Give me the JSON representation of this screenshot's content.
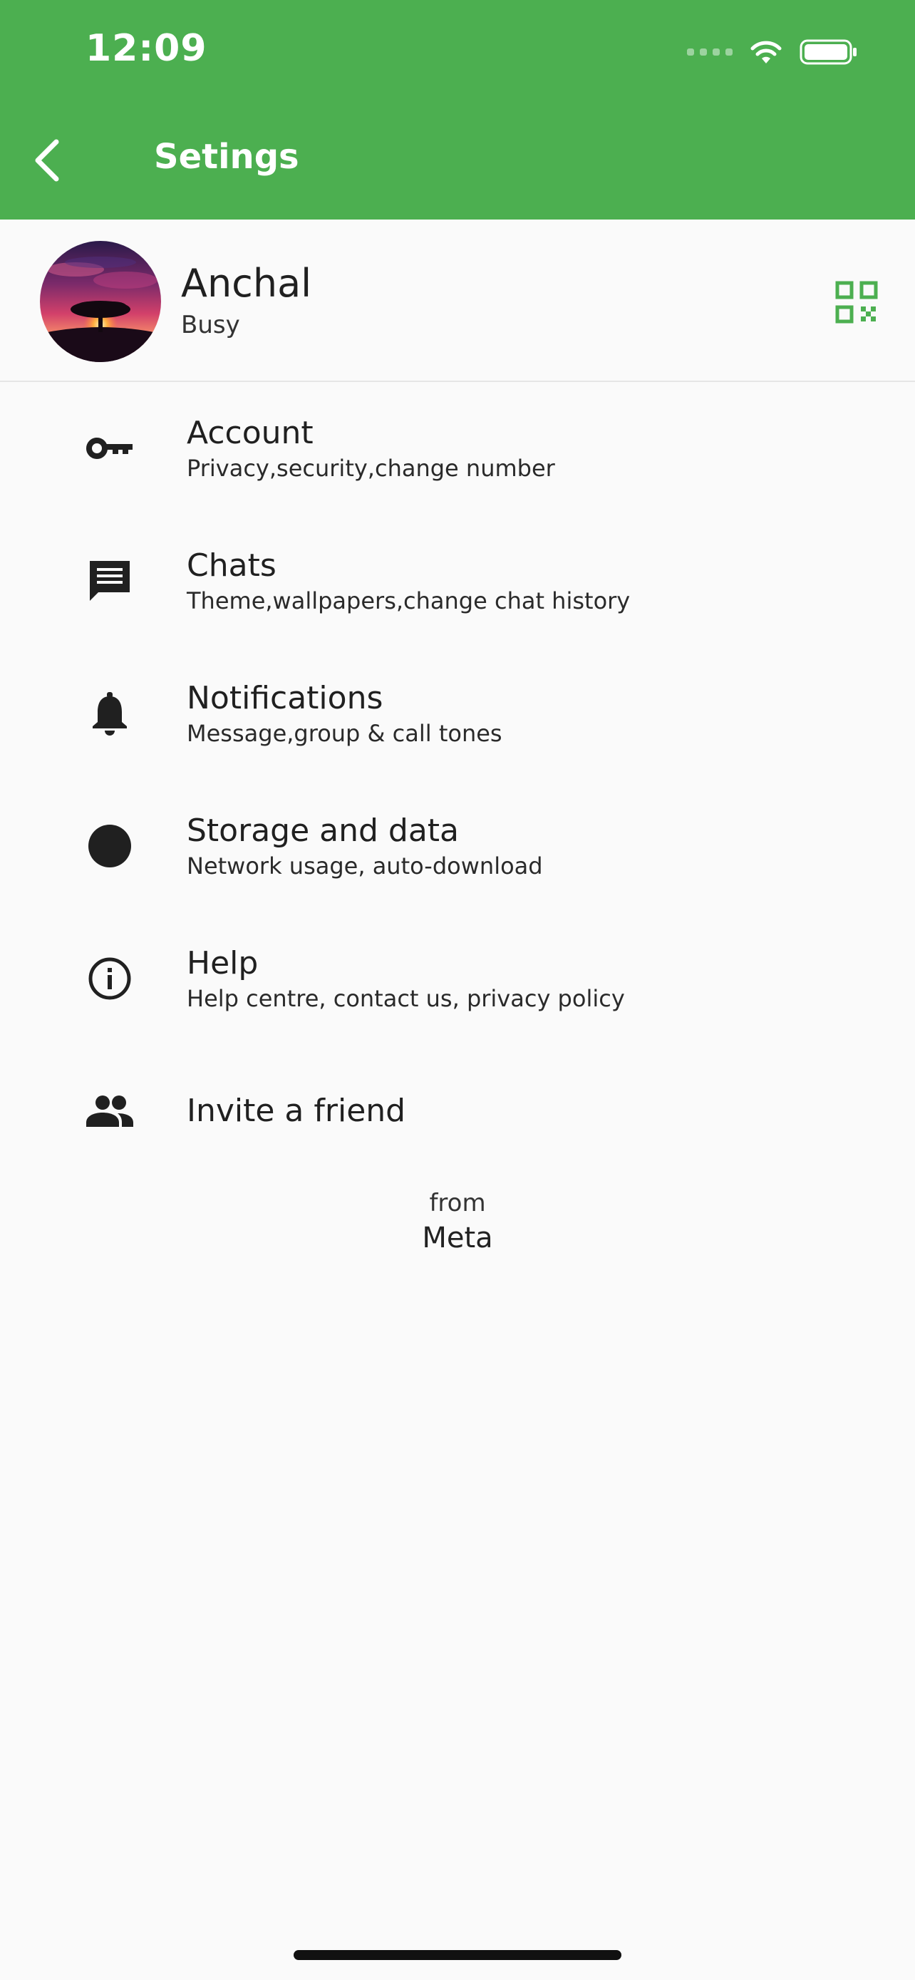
{
  "status_bar": {
    "time": "12:09"
  },
  "app_bar": {
    "title": "Setings",
    "back_icon": "chevron-left-icon",
    "background": "#4caf50"
  },
  "profile": {
    "name": "Anchal",
    "status": "Busy",
    "qr_icon": "qr-code-icon",
    "accent": "#4caf50"
  },
  "settings": [
    {
      "icon": "key-icon",
      "title": "Account",
      "subtitle": "Privacy,security,change number"
    },
    {
      "icon": "chat-icon",
      "title": "Chats",
      "subtitle": "Theme,wallpapers,change chat history"
    },
    {
      "icon": "bell-icon",
      "title": "Notifications",
      "subtitle": "Message,group & call tones"
    },
    {
      "icon": "circle-icon",
      "title": "Storage and data",
      "subtitle": "Network usage, auto-download"
    },
    {
      "icon": "info-icon",
      "title": "Help",
      "subtitle": "Help centre, contact us, privacy policy"
    },
    {
      "icon": "people-icon",
      "title": "Invite a friend",
      "subtitle": ""
    }
  ],
  "footer": {
    "from": "from",
    "brand": "Meta"
  }
}
